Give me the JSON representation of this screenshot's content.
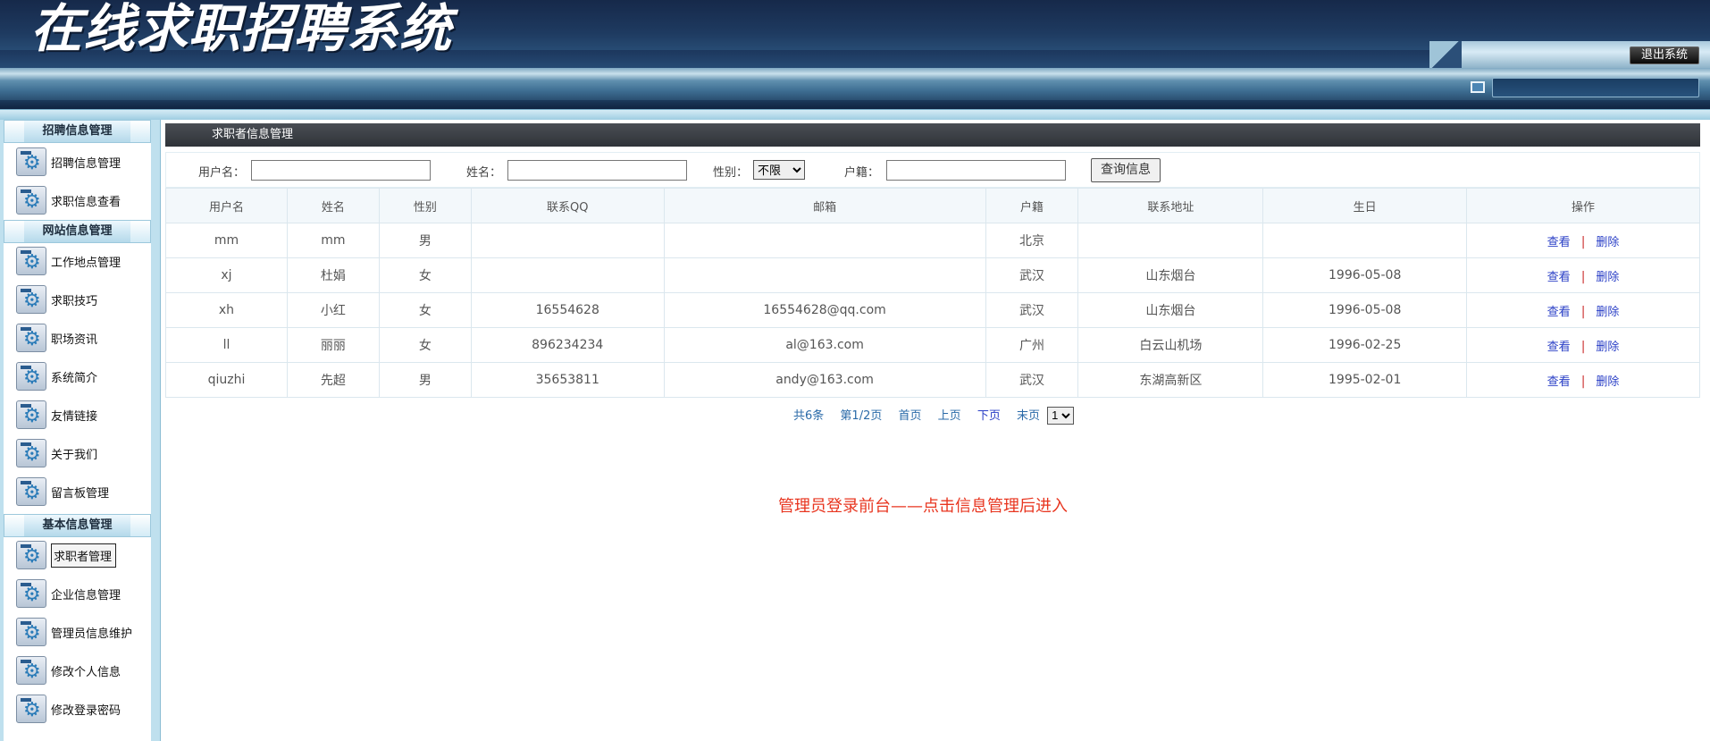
{
  "header": {
    "title": "在线求职招聘系统",
    "logout_label": "退出系统"
  },
  "sidebar": {
    "groups": [
      {
        "label": "招聘信息管理",
        "items": [
          "招聘信息管理",
          "求职信息查看"
        ]
      },
      {
        "label": "网站信息管理",
        "items": [
          "工作地点管理",
          "求职技巧",
          "职场资讯",
          "系统简介",
          "友情链接",
          "关于我们",
          "留言板管理"
        ]
      },
      {
        "label": "基本信息管理",
        "items": [
          "求职者管理",
          "企业信息管理",
          "管理员信息维护",
          "修改个人信息",
          "修改登录密码"
        ]
      }
    ],
    "active_item": "求职者管理"
  },
  "panel": {
    "title": "求职者信息管理"
  },
  "search": {
    "username_label": "用户名：",
    "username_value": "",
    "name_label": "姓名：",
    "name_value": "",
    "gender_label": "性别：",
    "gender_selected": "不限",
    "hukou_label": "户籍：",
    "hukou_value": "",
    "query_button": "查询信息"
  },
  "table": {
    "columns": [
      "用户名",
      "姓名",
      "性别",
      "联系QQ",
      "邮箱",
      "户籍",
      "联系地址",
      "生日",
      "操作"
    ],
    "rows": [
      [
        "mm",
        "mm",
        "男",
        "",
        "",
        "北京",
        "",
        ""
      ],
      [
        "xj",
        "杜娟",
        "女",
        "",
        "",
        "武汉",
        "山东烟台",
        "1996-05-08"
      ],
      [
        "xh",
        "小红",
        "女",
        "16554628",
        "16554628@qq.com",
        "武汉",
        "山东烟台",
        "1996-05-08"
      ],
      [
        "ll",
        "丽丽",
        "女",
        "896234234",
        "al@163.com",
        "广州",
        "白云山机场",
        "1996-02-25"
      ],
      [
        "qiuzhi",
        "先超",
        "男",
        "35653811",
        "andy@163.com",
        "武汉",
        "东湖高新区",
        "1995-02-01"
      ]
    ],
    "action_view": "查看",
    "action_sep": "|",
    "action_delete": "删除"
  },
  "pager": {
    "total": "共6条",
    "page_info": "第1/2页",
    "first": "首页",
    "prev": "上页",
    "next": "下页",
    "last": "末页",
    "page_selected": "1"
  },
  "note": "管理员登录前台——点击信息管理后进入"
}
